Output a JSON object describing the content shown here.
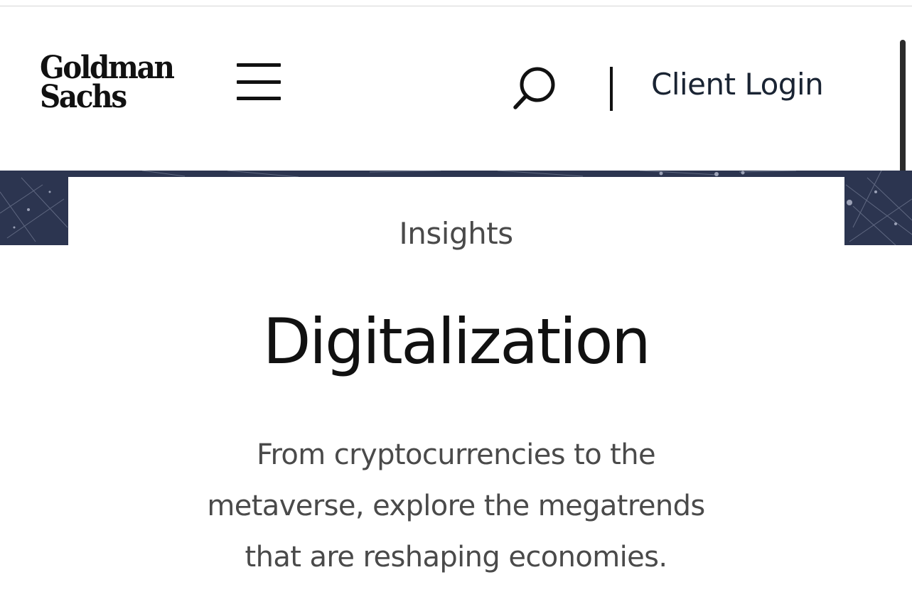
{
  "header": {
    "logo": {
      "line1": "Goldman",
      "line2": "Sachs"
    },
    "menu_icon": "hamburger-menu-icon",
    "search_icon": "search-icon",
    "client_login_label": "Client Login"
  },
  "hero": {
    "eyebrow": "Insights",
    "title": "Digitalization",
    "description_lines": [
      "From cryptocurrencies to the",
      "metaverse, explore the megatrends",
      "that are reshaping economies."
    ]
  },
  "colors": {
    "text_primary": "#111111",
    "text_secondary": "#4a4a4a",
    "login_text": "#1a2433",
    "hero_band": "#2c3550"
  }
}
